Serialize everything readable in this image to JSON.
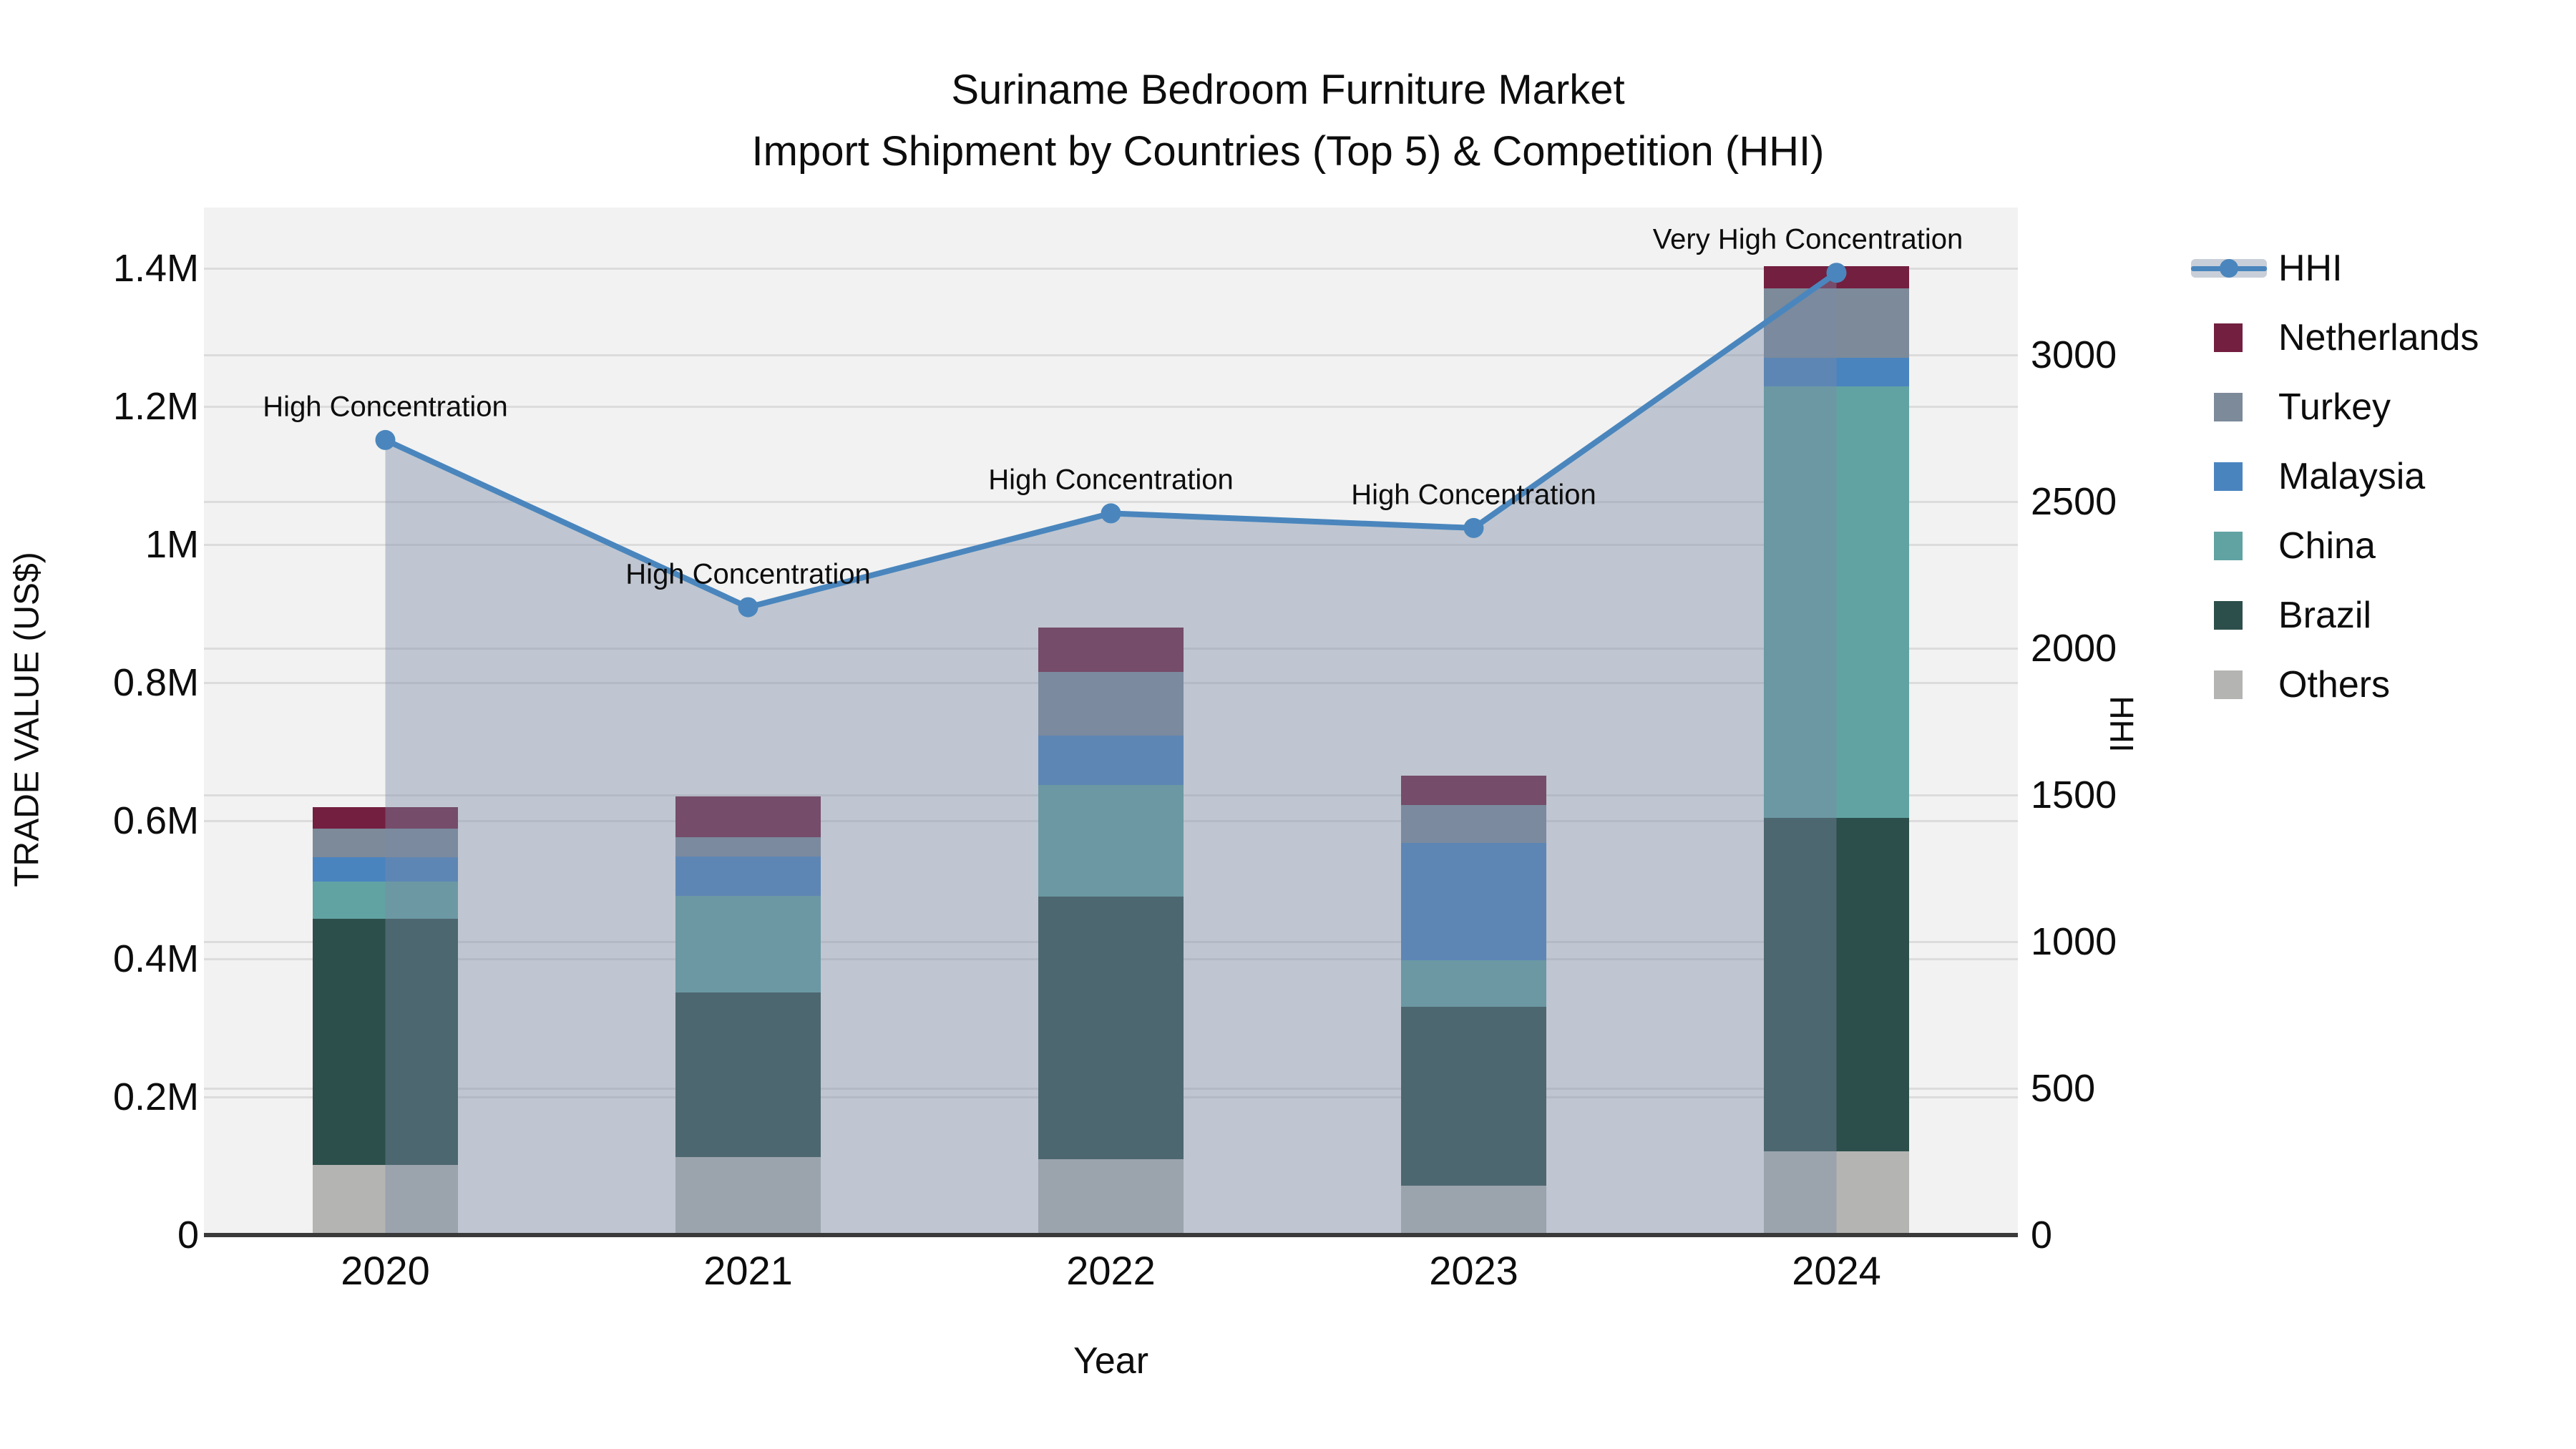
{
  "title": {
    "line1": "Suriname Bedroom Furniture Market",
    "line2": "Import Shipment by Countries (Top 5) & Competition (HHI)"
  },
  "axes": {
    "y_left": {
      "label": "TRADE VALUE (US$)",
      "ticks": [
        {
          "text": "0",
          "value": 0
        },
        {
          "text": "0.2M",
          "value": 0.2
        },
        {
          "text": "0.4M",
          "value": 0.4
        },
        {
          "text": "0.6M",
          "value": 0.6
        },
        {
          "text": "0.8M",
          "value": 0.8
        },
        {
          "text": "1M",
          "value": 1.0
        },
        {
          "text": "1.2M",
          "value": 1.2
        },
        {
          "text": "1.4M",
          "value": 1.4
        }
      ]
    },
    "y_right": {
      "label": "HHI",
      "ticks": [
        {
          "text": "0",
          "value": 0
        },
        {
          "text": "500",
          "value": 500
        },
        {
          "text": "1000",
          "value": 1000
        },
        {
          "text": "1500",
          "value": 1500
        },
        {
          "text": "2000",
          "value": 2000
        },
        {
          "text": "2500",
          "value": 2500
        },
        {
          "text": "3000",
          "value": 3000
        }
      ]
    },
    "x": {
      "label": "Year",
      "ticks": [
        "2020",
        "2021",
        "2022",
        "2023",
        "2024"
      ]
    }
  },
  "chart_data": {
    "type": "stacked-bar-with-line",
    "categories": [
      2020,
      2021,
      2022,
      2023,
      2024
    ],
    "value_unit": "Million US$",
    "stack_order": [
      "Others",
      "Brazil",
      "China",
      "Malaysia",
      "Turkey",
      "Netherlands"
    ],
    "series": [
      {
        "name": "Others",
        "color": "#b4b5b3",
        "values": [
          0.102,
          0.113,
          0.11,
          0.072,
          0.121
        ]
      },
      {
        "name": "Brazil",
        "color": "#2d4f4b",
        "values": [
          0.356,
          0.238,
          0.38,
          0.259,
          0.483
        ]
      },
      {
        "name": "China",
        "color": "#61a3a3",
        "values": [
          0.054,
          0.14,
          0.162,
          0.067,
          0.625
        ]
      },
      {
        "name": "Malaysia",
        "color": "#4a84bf",
        "values": [
          0.035,
          0.057,
          0.071,
          0.17,
          0.041
        ]
      },
      {
        "name": "Turkey",
        "color": "#7c8a99",
        "values": [
          0.042,
          0.028,
          0.093,
          0.055,
          0.101
        ]
      },
      {
        "name": "Netherlands",
        "color": "#731f40",
        "values": [
          0.031,
          0.059,
          0.064,
          0.042,
          0.032
        ]
      }
    ],
    "bar_totals": [
      0.62,
      0.635,
      0.88,
      0.665,
      1.4
    ],
    "hhi": {
      "name": "HHI",
      "color": "#4a86bd",
      "fill_color": "rgba(121,138,164,0.42)",
      "values": [
        2710,
        2140,
        2460,
        2410,
        3280
      ],
      "annotations": [
        {
          "year": 2020,
          "text": "High Concentration"
        },
        {
          "year": 2021,
          "text": "High Concentration"
        },
        {
          "year": 2022,
          "text": "High Concentration"
        },
        {
          "year": 2023,
          "text": "High Concentration"
        },
        {
          "year": 2024,
          "text": "Very High Concentration"
        }
      ]
    },
    "ylim_left": [
      0,
      1.4
    ],
    "ylim_right": [
      0,
      3500
    ],
    "grid": true,
    "legend_position": "right"
  },
  "legend": {
    "items": [
      {
        "label": "HHI",
        "type": "line",
        "color": "#4a86bd"
      },
      {
        "label": "Netherlands",
        "type": "swatch",
        "color": "#731f40"
      },
      {
        "label": "Turkey",
        "type": "swatch",
        "color": "#7c8a99"
      },
      {
        "label": "Malaysia",
        "type": "swatch",
        "color": "#4a84bf"
      },
      {
        "label": "China",
        "type": "swatch",
        "color": "#61a3a3"
      },
      {
        "label": "Brazil",
        "type": "swatch",
        "color": "#2d4f4b"
      },
      {
        "label": "Others",
        "type": "swatch",
        "color": "#b4b5b3"
      }
    ]
  },
  "colors": {
    "plot_background": "#f2f2f2",
    "gridline": "#dcdcdc",
    "axis_line": "#3a3a3a",
    "hhi_line": "#4a86bd",
    "hhi_area_fill": "rgba(121,138,164,0.42)"
  }
}
